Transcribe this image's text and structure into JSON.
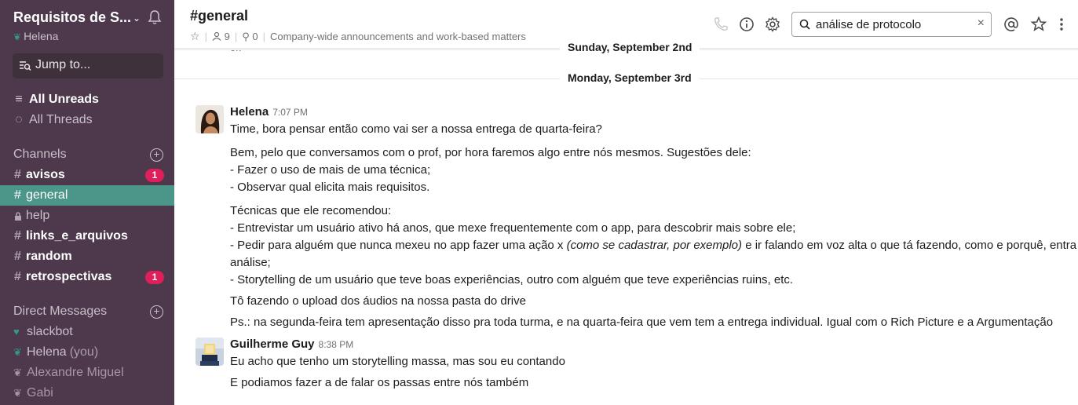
{
  "team": {
    "name": "Requisitos de S...",
    "user": "Helena"
  },
  "jump": {
    "label": "Jump to..."
  },
  "nav": {
    "all_unreads": "All Unreads",
    "all_threads": "All Threads"
  },
  "channels": {
    "title": "Channels",
    "items": [
      {
        "name": "avisos",
        "badge": "1"
      },
      {
        "name": "general"
      },
      {
        "name": "help"
      },
      {
        "name": "links_e_arquivos"
      },
      {
        "name": "random"
      },
      {
        "name": "retrospectivas",
        "badge": "1"
      }
    ]
  },
  "dms": {
    "title": "Direct Messages",
    "items": [
      {
        "name": "slackbot"
      },
      {
        "name": "Helena",
        "suffix": "(you)"
      },
      {
        "name": "Alexandre Miguel"
      },
      {
        "name": "Gabi"
      }
    ]
  },
  "header": {
    "title": "#general",
    "members": "9",
    "pins": "0",
    "topic": "Company-wide announcements and work-based matters"
  },
  "search": {
    "value": "análise de protocolo",
    "clear": "×"
  },
  "partial": {
    "text": "ok"
  },
  "dividers": [
    "Sunday, September 2nd",
    "Monday, September 3rd"
  ],
  "messages": [
    {
      "author": "Helena",
      "time": "7:07 PM",
      "lines": [
        "Time, bora pensar então como vai ser a nossa entrega de quarta-feira?",
        "Bem, pelo que conversamos com o prof, por hora faremos algo entre nós mesmos. Sugestões dele:",
        "- Fazer o uso de mais de uma técnica;",
        "- Observar qual elicita mais requisitos.",
        "Técnicas que ele recomendou:",
        "- Entrevistar um usuário ativo há anos, que mexe frequentemente com o app, para descobrir mais sobre ele;",
        "- Pedir para alguém que nunca mexeu no app fazer uma ação x ",
        "(como se cadastrar, por exemplo)",
        " e ir falando em voz alta o que tá fazendo, como e porquê, entra na",
        "análise;",
        "- Storytelling de um usuário que teve boas experiências, outro com alguém que teve experiências ruins, etc.",
        "Tô fazendo o upload dos áudios na nossa pasta do drive",
        "Ps.: na segunda-feira tem apresentação disso pra toda turma, e na quarta-feira que vem tem a entrega individual. Igual com o Rich Picture e a Argumentação"
      ]
    },
    {
      "author": "Guilherme Guy",
      "time": "8:38 PM",
      "lines": [
        "Eu acho que tenho um storytelling massa, mas sou eu contando",
        "E podiamos fazer a de falar os passas entre nós também"
      ]
    }
  ]
}
